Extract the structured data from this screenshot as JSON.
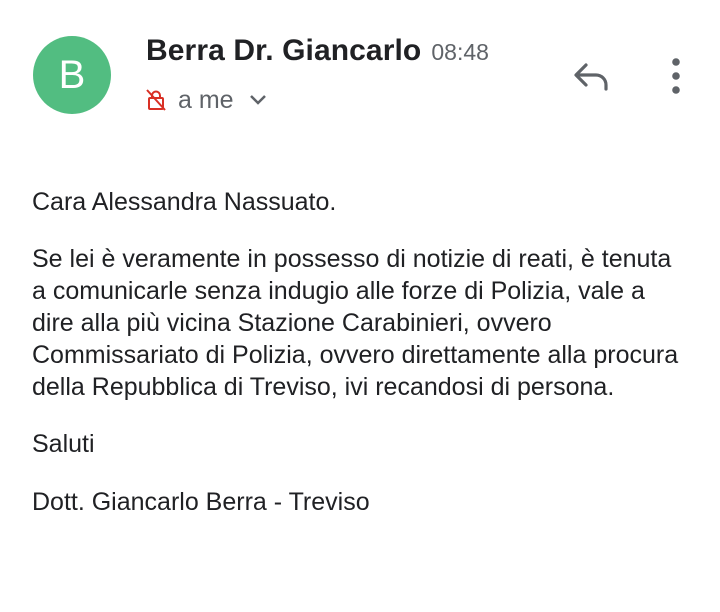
{
  "header": {
    "avatar_letter": "B",
    "sender_name": "Berra Dr. Giancarlo",
    "time": "08:48",
    "recipient": "a me",
    "icons": {
      "lock": "lock-off-icon",
      "chevron": "chevron-down-icon",
      "reply": "reply-icon",
      "more": "more-vert-icon"
    },
    "colors": {
      "avatar_bg": "#52bd81",
      "lock": "#d93025"
    }
  },
  "body": {
    "greeting": "Cara Alessandra Nassuato.",
    "paragraph": "Se lei è veramente in possesso di notizie di reati, è tenuta a comunicarle senza indugio alle forze di Polizia, vale a dire alla più vicina Stazione Carabinieri, ovvero Commissariato di Polizia, ovvero direttamente alla procura della Repubblica di Treviso, ivi recandosi di persona.",
    "closing": "Saluti",
    "signature": "Dott. Giancarlo Berra - Treviso"
  }
}
